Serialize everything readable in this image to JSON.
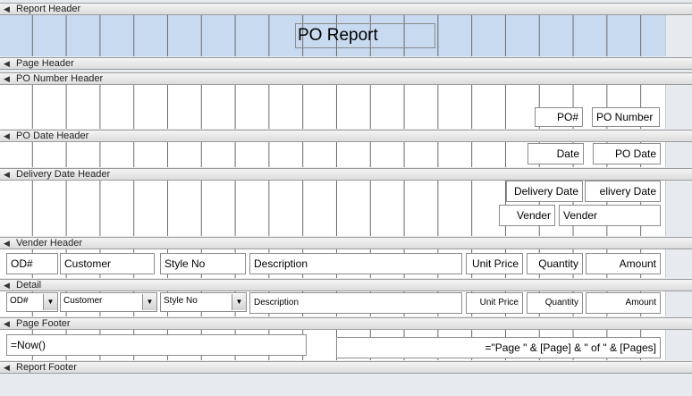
{
  "sections": {
    "report_header": "Report Header",
    "page_header": "Page Header",
    "po_number_header": "PO Number Header",
    "po_date_header": "PO Date Header",
    "delivery_date_header": "Delivery Date Header",
    "vender_header": "Vender Header",
    "detail": "Detail",
    "page_footer": "Page Footer",
    "report_footer": "Report Footer"
  },
  "report_header": {
    "title": "PO Report"
  },
  "po_number_header": {
    "label": "PO#",
    "field": "PO Number"
  },
  "po_date_header": {
    "label": "Date",
    "field": "PO Date"
  },
  "delivery_date_header": {
    "label": "Delivery Date",
    "field": "elivery Date",
    "vender_label": "Vender",
    "vender_field": "Vender"
  },
  "vender_header": {
    "od": "OD#",
    "customer": "Customer",
    "style_no": "Style No",
    "description": "Description",
    "unit_price": "Unit Price",
    "quantity": "Quantity",
    "amount": "Amount"
  },
  "detail": {
    "od": "OD#",
    "customer": "Customer",
    "style_no": "Style No",
    "description": "Description",
    "unit_price": "Unit Price",
    "quantity": "Quantity",
    "amount": "Amount"
  },
  "page_footer": {
    "date_expr": "=Now()",
    "page_expr": "=\"Page \" & [Page] & \" of \" & [Pages]"
  },
  "icons": {
    "section_toggle": "section-collapse-icon",
    "dropdown": "dropdown-arrow-icon"
  }
}
